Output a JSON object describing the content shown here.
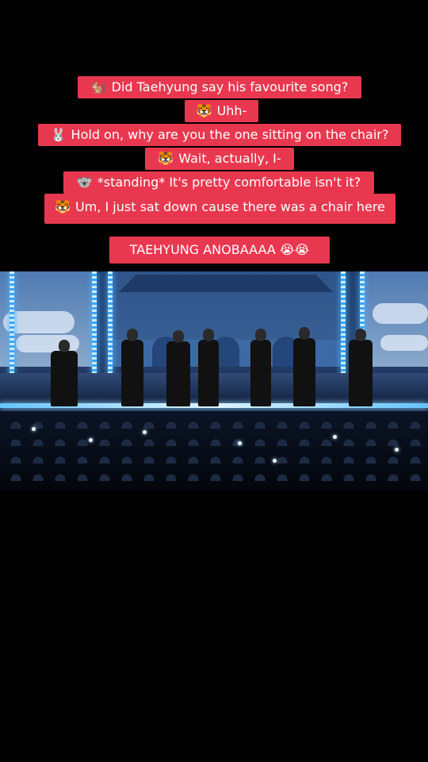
{
  "captions": [
    {
      "emoji": "🐿️",
      "text": "Did Taehyung say his favourite song?"
    },
    {
      "emoji": "🐯",
      "text": "Uhh-"
    },
    {
      "emoji": "🐰",
      "text": "Hold on, why are you the one sitting on the chair?"
    },
    {
      "emoji": "🐯",
      "text": "Wait, actually, I-"
    },
    {
      "emoji": "🐨",
      "text": "*standing* It's pretty comfortable isn't it?"
    },
    {
      "emoji": "🐯",
      "text": "Um, I just sat down cause there was a chair here"
    }
  ],
  "footer_caption": "TAEHYUNG ANOBAAAA 😭😭",
  "colors": {
    "caption_bg": "#e8384f",
    "caption_text": "#ffffff",
    "background": "#000000"
  },
  "video": {
    "description_icon": "stage-video-frame"
  }
}
